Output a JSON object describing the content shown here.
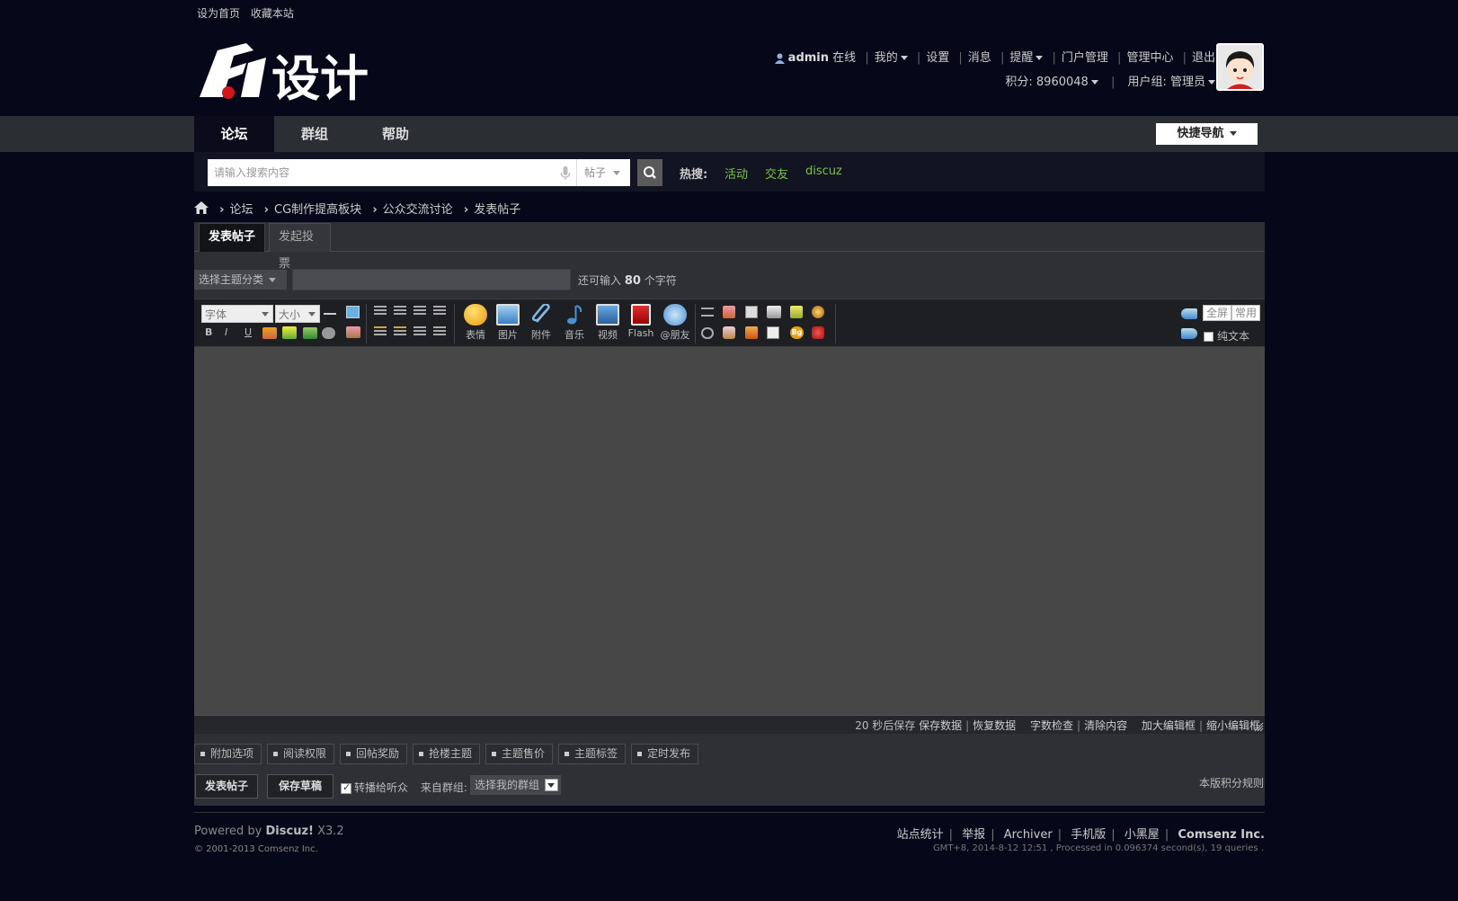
{
  "top_links": [
    "设为首页",
    "收藏本站"
  ],
  "logo_text": "设计",
  "user": {
    "name": "admin",
    "status": "在线",
    "menu": [
      "我的",
      "设置",
      "消息",
      "提醒",
      "门户管理",
      "管理中心",
      "退出"
    ],
    "points_label": "积分: 8960048",
    "group_label": "用户组: 管理员"
  },
  "nav": {
    "items": [
      "论坛",
      "群组",
      "帮助"
    ],
    "quick_nav": "快捷导航"
  },
  "search": {
    "placeholder": "请输入搜索内容",
    "type": "帖子",
    "hot_label": "热搜:",
    "hot_terms": [
      "活动",
      "交友",
      "discuz"
    ]
  },
  "breadcrumb": [
    "论坛",
    "CG制作提高板块",
    "公众交流讨论",
    "发表帖子"
  ],
  "tabs": [
    "发表帖子",
    "发起投票"
  ],
  "post": {
    "category_placeholder": "选择主题分类",
    "char_prefix": "还可输入",
    "char_count": "80",
    "char_suffix": "个字符"
  },
  "toolbar": {
    "font_select": "字体",
    "size_select": "大小",
    "big_buttons": [
      "表情",
      "图片",
      "附件",
      "音乐",
      "视频",
      "Flash",
      "@朋友"
    ],
    "fullscreen": "全屏",
    "common": "常用",
    "plain_text": "纯文本"
  },
  "statusbar": {
    "autosave": "20 秒后保存",
    "save": "保存数据",
    "restore": "恢复数据",
    "check": "字数检查",
    "clear": "清除内容",
    "enlarge": "加大编辑框",
    "shrink": "缩小编辑框"
  },
  "options": [
    "附加选项",
    "阅读权限",
    "回帖奖励",
    "抢楼主题",
    "主题售价",
    "主题标签",
    "定时发布"
  ],
  "actions": {
    "submit": "发表帖子",
    "draft": "保存草稿",
    "relay": "转播给听众",
    "from_group_label": "来自群组:",
    "group_select": "选择我的群组",
    "rules": "本版积分规则"
  },
  "footer": {
    "powered_prefix": "Powered by",
    "powered_brand": "Discuz!",
    "powered_version": "X3.2",
    "copyright": "© 2001-2013 Comsenz Inc.",
    "links": [
      "站点统计",
      "举报",
      "Archiver",
      "手机版",
      "小黑屋"
    ],
    "company": "Comsenz Inc.",
    "gmt": "GMT+8, 2014-8-12 12:51 , Processed in 0.096374 second(s), 19 queries ."
  },
  "colors": {
    "background": "#07071a",
    "nav_bar": "#2b2e33",
    "hot_terms": "#7ac143",
    "editor_bg": "#474747"
  }
}
